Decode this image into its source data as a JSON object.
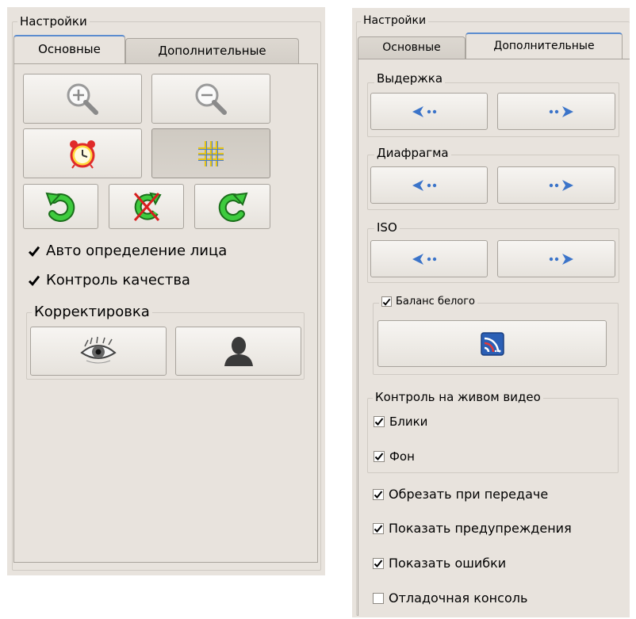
{
  "left_panel": {
    "title": "Настройки",
    "tabs": [
      {
        "label": "Основные",
        "active": true
      },
      {
        "label": "Дополнительные",
        "active": false
      }
    ],
    "tool_buttons": [
      {
        "icon": "zoom-in-icon"
      },
      {
        "icon": "zoom-out-icon"
      },
      {
        "icon": "alarm-clock-icon"
      },
      {
        "icon": "grid-icon",
        "pressed": true
      },
      {
        "icon": "rotate-left-icon"
      },
      {
        "icon": "reset-rotation-icon"
      },
      {
        "icon": "rotate-right-icon"
      }
    ],
    "checkboxes": [
      {
        "label": "Авто определение лица",
        "checked": true
      },
      {
        "label": "Контроль качества",
        "checked": true
      }
    ],
    "correction_group": {
      "title": "Корректировка",
      "buttons": [
        {
          "icon": "eye-icon"
        },
        {
          "icon": "person-silhouette-icon"
        }
      ]
    }
  },
  "right_panel": {
    "title": "Настройки",
    "tabs": [
      {
        "label": "Основные",
        "active": false
      },
      {
        "label": "Дополнительные",
        "active": true
      }
    ],
    "exposure_group": {
      "title": "Выдержка"
    },
    "aperture_group": {
      "title": "Диафрагма"
    },
    "iso_group": {
      "title": "ISO"
    },
    "white_balance": {
      "label": "Баланс белого",
      "checked": true,
      "icon": "white-balance-icon"
    },
    "live_video_group": {
      "title": "Контроль на живом видео",
      "checkboxes": [
        {
          "label": "Блики",
          "checked": true
        },
        {
          "label": "Фон",
          "checked": true
        }
      ]
    },
    "options": [
      {
        "label": "Обрезать при передаче",
        "checked": true
      },
      {
        "label": "Показать предупреждения",
        "checked": true
      },
      {
        "label": "Показать ошибки",
        "checked": true
      },
      {
        "label": "Отладочная консоль",
        "checked": false
      }
    ]
  },
  "colors": {
    "panel_bg": "#e8e3dd",
    "tab_accent": "#5b8ccf",
    "arrow_blue": "#3b74c9",
    "icon_green": "#2fae2f"
  }
}
